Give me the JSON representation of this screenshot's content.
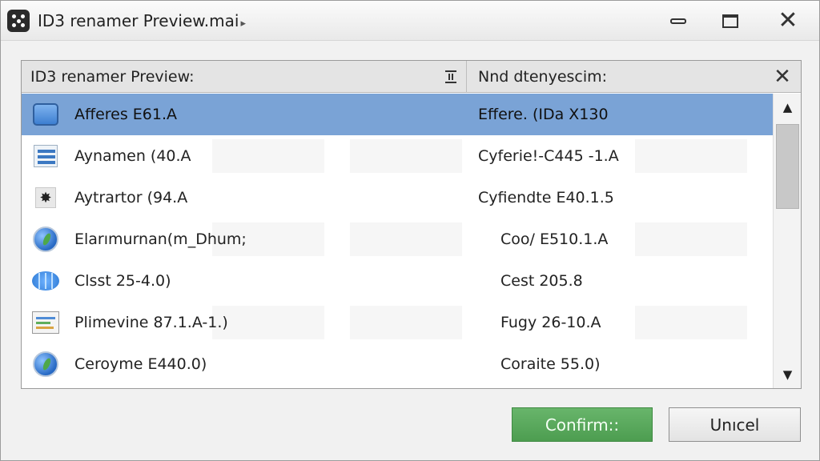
{
  "window": {
    "title": "ID3 renamer Preview.mai",
    "title_suffix": "▸"
  },
  "list": {
    "header_left": "ID3 renamer Preview:",
    "header_right": "Nnd dtenyescim:",
    "rows": [
      {
        "icon": "app-window-icon",
        "name": "Afferes E61.A",
        "new_name": "Effere. (IDa X130",
        "selected": true
      },
      {
        "icon": "list-lines-icon",
        "name": "Aynamen (40.A",
        "new_name": "Cyferie!-C445 -1.A",
        "selected": false
      },
      {
        "icon": "gear-icon",
        "name": "Aytrartor (94.A",
        "new_name": "Cyfiendte E40.1.5",
        "selected": false
      },
      {
        "icon": "globe-icon",
        "name": "Elarımurnan(m_Dhum;",
        "new_name": "Coo/ E510.1.A",
        "selected": false
      },
      {
        "icon": "chip-icon",
        "name": "Clsst 25-4.0)",
        "new_name": "Cest 205.8",
        "selected": false
      },
      {
        "icon": "panel-icon",
        "name": "Plimevine 87.1.A-1.)",
        "new_name": "Fugy 26-10.A",
        "selected": false
      },
      {
        "icon": "globe-icon",
        "name": "Ceroyme E440.0)",
        "new_name": "Coraite 55.0)",
        "selected": false
      }
    ]
  },
  "buttons": {
    "confirm": "Confirm::",
    "cancel": "Unıcel"
  },
  "colors": {
    "selection": "#7aa3d6",
    "confirm": "#5aa95d"
  }
}
